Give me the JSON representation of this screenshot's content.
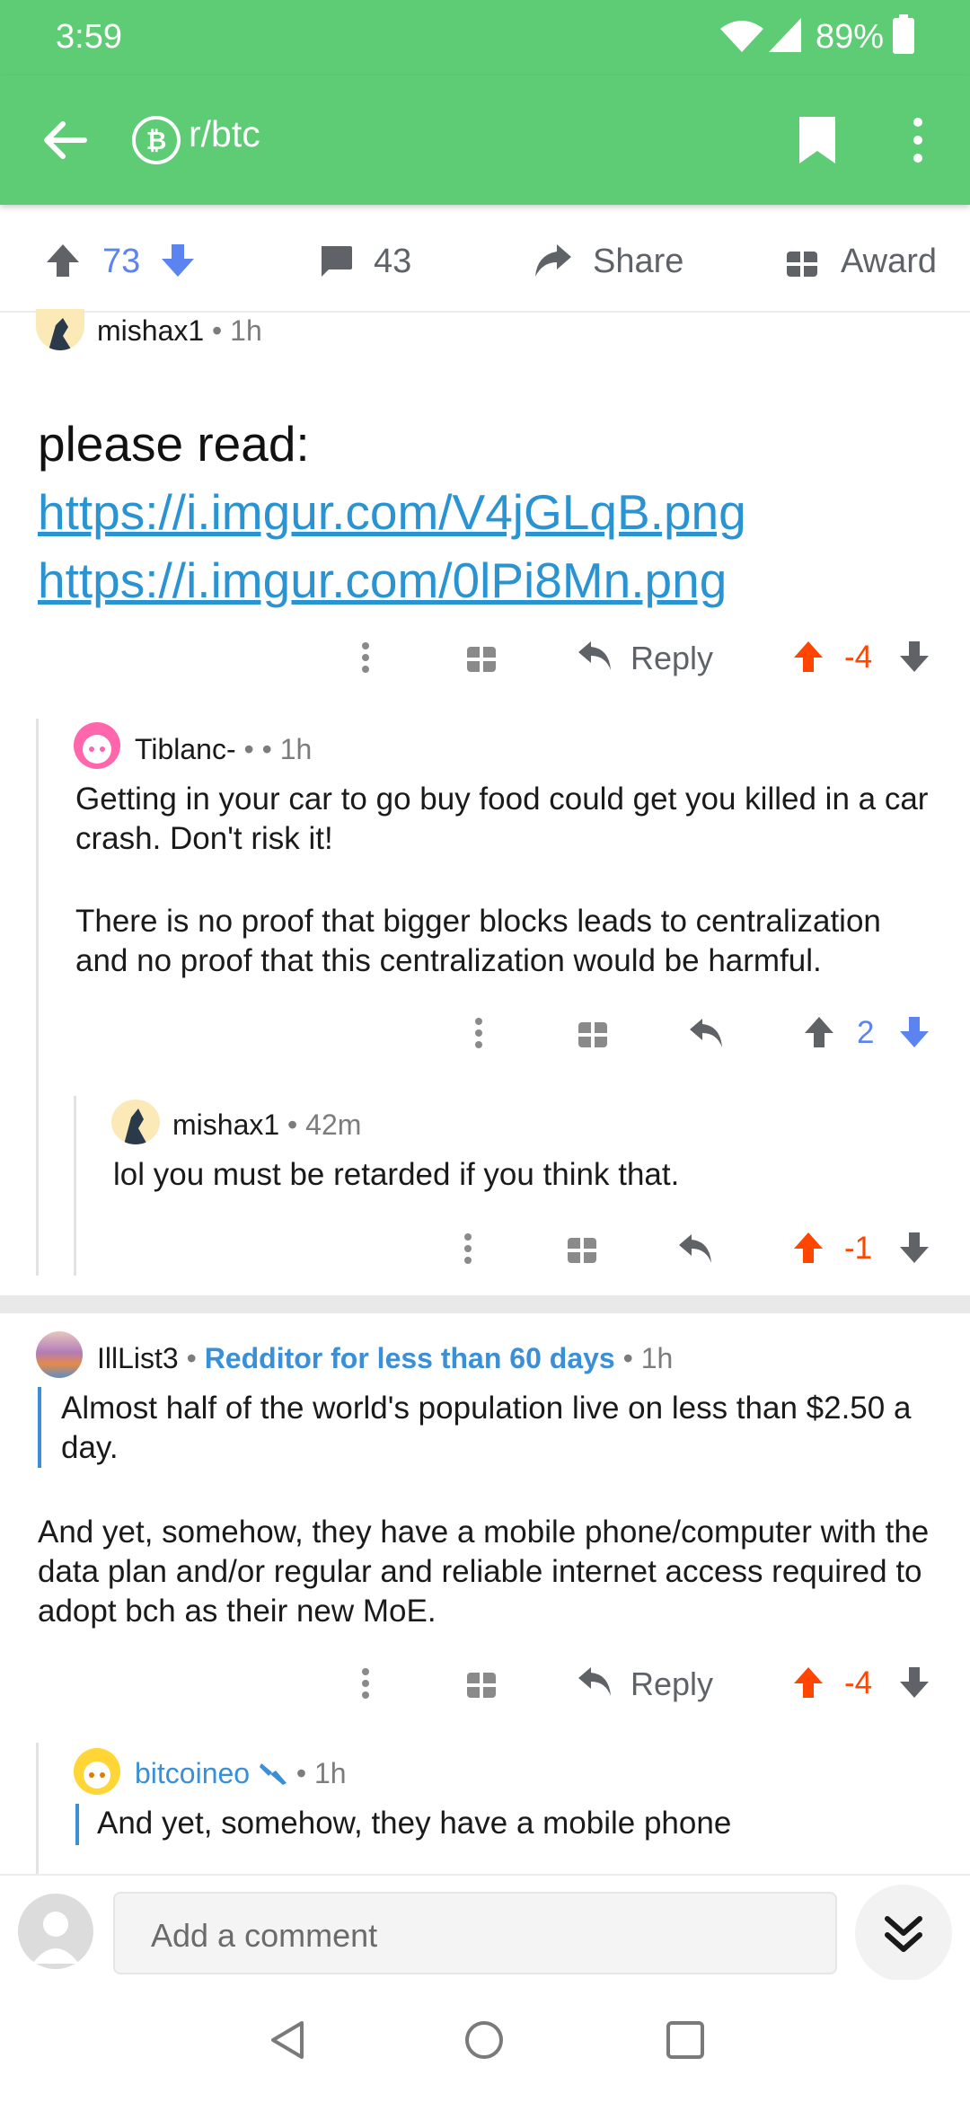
{
  "status": {
    "time": "3:59",
    "battery": "89%"
  },
  "header": {
    "subreddit": "r/btc"
  },
  "post_actions": {
    "upvotes": "73",
    "comments": "43",
    "share": "Share",
    "award": "Award"
  },
  "comments": [
    {
      "author": "mishax1",
      "time": "1h",
      "title_text": "please read:",
      "links": [
        "https://i.imgur.com/V4jGLqB.png",
        "https://i.imgur.com/0lPi8Mn.png"
      ],
      "reply_label": "Reply",
      "score": "-4"
    },
    {
      "author": "Tiblanc-",
      "time": "1h",
      "paragraphs": [
        "Getting in your car to go buy food could get you killed in a car crash. Don't risk it!",
        "There is no proof that bigger blocks leads to centralization and no proof that this centralization would be harmful."
      ],
      "score": "2"
    },
    {
      "author": "mishax1",
      "time": "42m",
      "text": "lol you must be retarded if you think that.",
      "score": "-1"
    },
    {
      "author": "IllList3",
      "flair": "Redditor for less than 60 days",
      "time": "1h",
      "quote": "Almost half of the world's population live on less than $2.50 a day.",
      "text": "And yet, somehow, they have a mobile phone/computer with the data plan and/or regular and reliable internet access required to adopt bch as their new MoE.",
      "reply_label": "Reply",
      "score": "-4"
    },
    {
      "author": "bitcoineo",
      "time": "1h",
      "quote": "And yet, somehow, they have a mobile phone"
    }
  ],
  "composer": {
    "placeholder": "Add a comment"
  },
  "icons": {
    "status": [
      "wifi-icon",
      "signal-icon",
      "battery-icon"
    ],
    "header": [
      "back-arrow-icon",
      "bitcoin-icon",
      "bookmark-icon",
      "more-vert-icon"
    ],
    "actions": [
      "upvote-icon",
      "downvote-icon",
      "comment-icon",
      "share-icon",
      "award-icon",
      "gift-icon",
      "reply-icon",
      "more-dots-icon"
    ],
    "nav": [
      "nav-back-icon",
      "nav-home-icon",
      "nav-recents-icon",
      "collapse-down-icon"
    ]
  },
  "colors": {
    "header": "#5ecb75",
    "upvote": "#ff4500",
    "downvote": "#5c84f0",
    "link": "#2a93d1"
  }
}
